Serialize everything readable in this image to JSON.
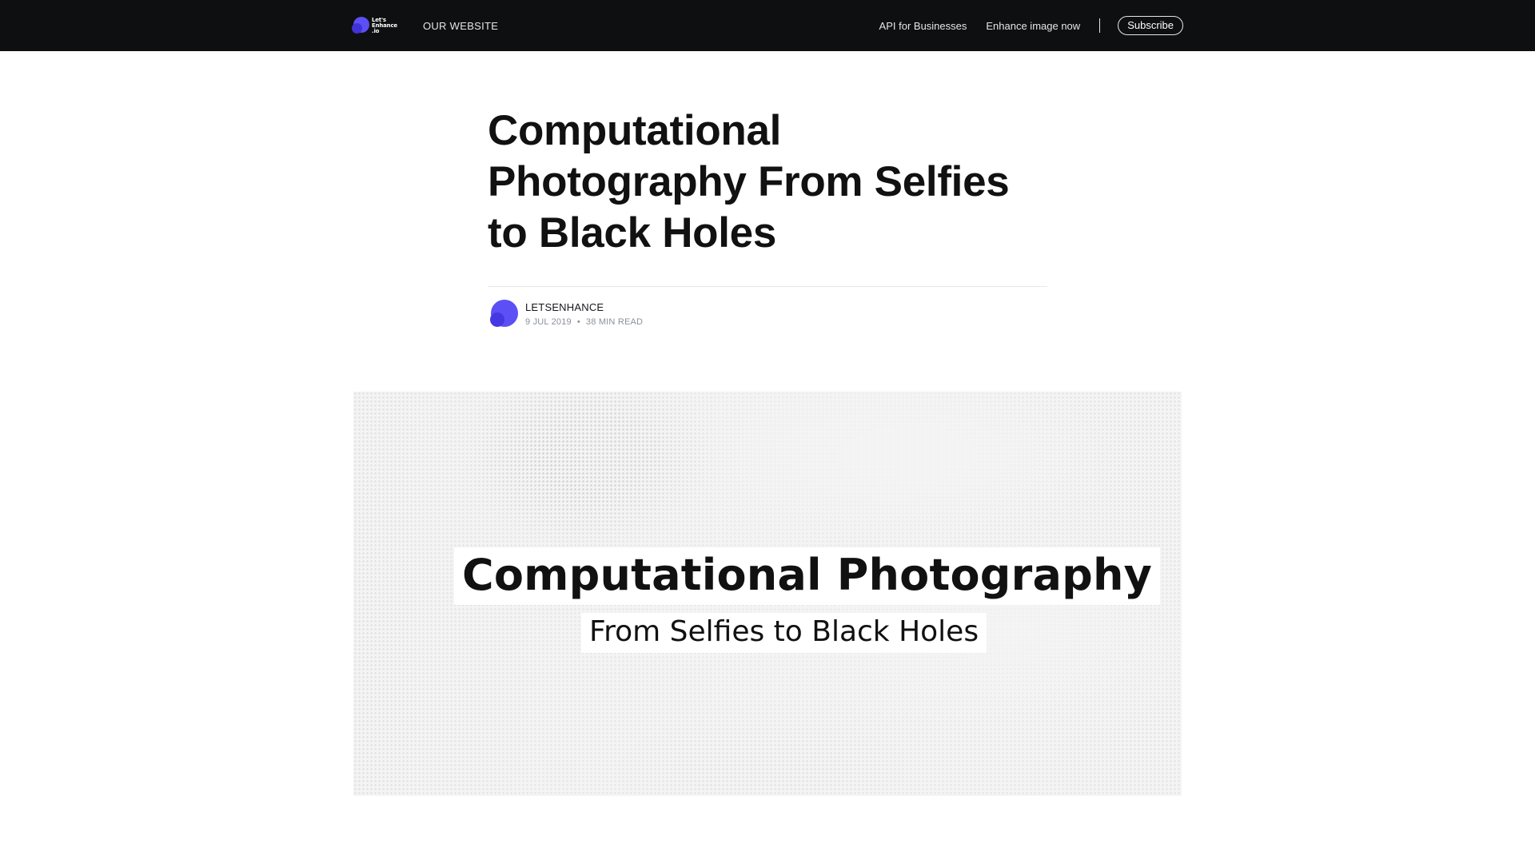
{
  "header": {
    "logo_lines": [
      "Let's",
      "Enhance",
      ".io"
    ],
    "our_website": "OUR WEBSITE",
    "api_link": "API for Businesses",
    "enhance_link": "Enhance image now",
    "subscribe": "Subscribe"
  },
  "article": {
    "title": "Computational Photography From Selfies to Black Holes",
    "author": "LETSENHANCE",
    "date": "9 JUL 2019",
    "separator": "•",
    "read_time": "38 MIN READ"
  },
  "feature_image": {
    "title": "Computational Photography",
    "subtitle": "From Selfies to Black Holes"
  },
  "colors": {
    "header_bg": "#0e0f11",
    "brand_blue": "#5b4ff5",
    "meta_grey": "#8a9199"
  }
}
